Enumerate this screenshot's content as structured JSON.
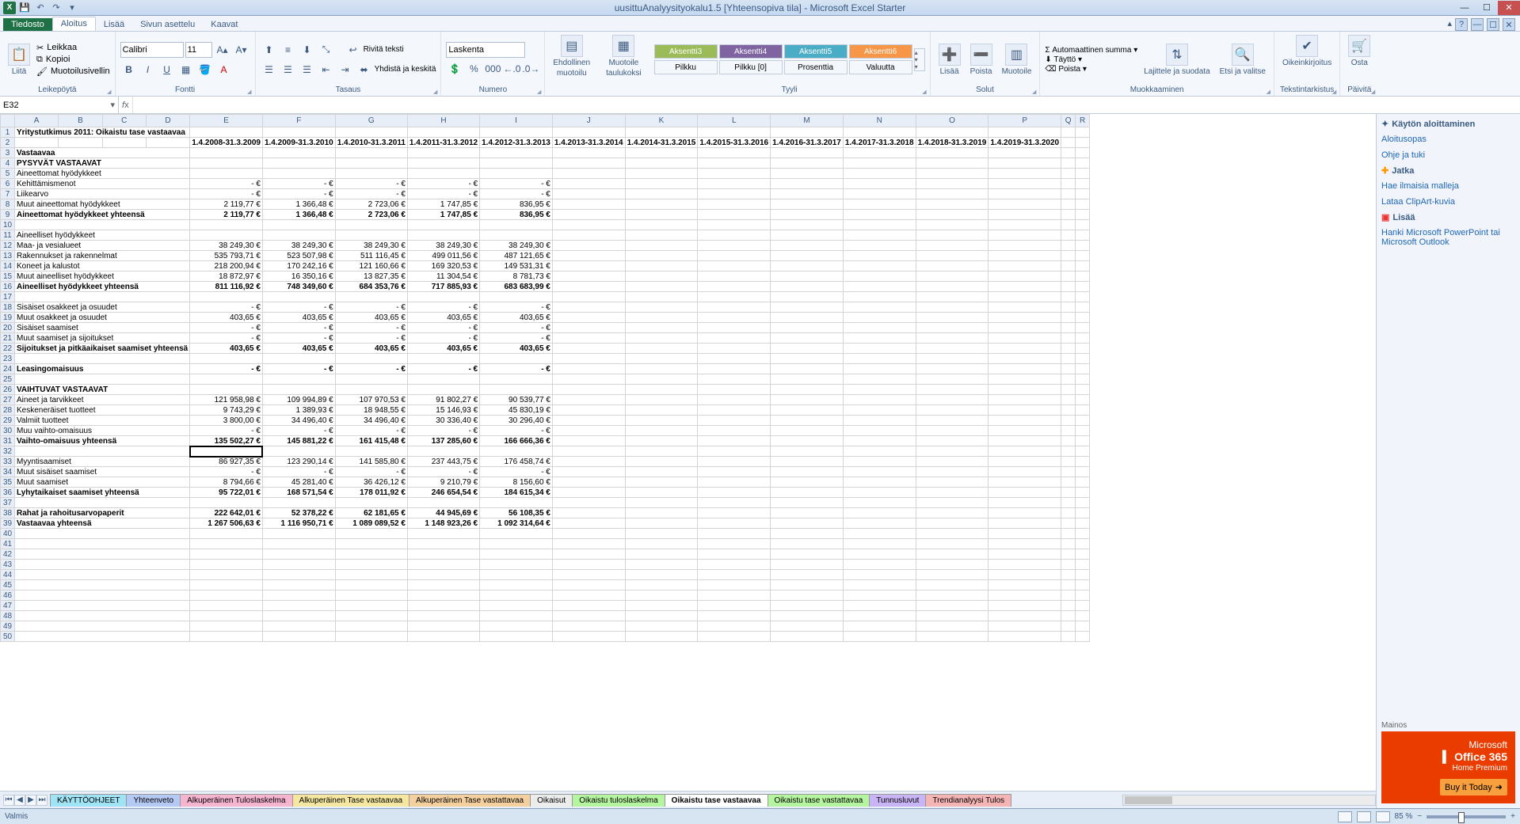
{
  "app": {
    "title": "uusittuAnalyysityokalu1.5 [Yhteensopiva tila] - Microsoft Excel Starter",
    "status": "Valmis",
    "zoom": "85 %"
  },
  "tabs": {
    "file": "Tiedosto",
    "items": [
      "Aloitus",
      "Lisää",
      "Sivun asettelu",
      "Kaavat"
    ],
    "active": "Aloitus"
  },
  "ribbon": {
    "clipboard": {
      "label": "Leikepöytä",
      "paste": "Liitä",
      "cut": "Leikkaa",
      "copy": "Kopioi",
      "painter": "Muotoilusivellin"
    },
    "font": {
      "label": "Fontti",
      "name": "Calibri",
      "size": "11"
    },
    "align": {
      "label": "Tasaus",
      "wrap": "Rivitä teksti",
      "merge": "Yhdistä ja keskitä"
    },
    "number": {
      "label": "Numero",
      "format": "Laskenta"
    },
    "cond": {
      "label1": "Ehdollinen",
      "label2": "muotoilu"
    },
    "fmttable": {
      "label1": "Muotoile",
      "label2": "taulukoksi"
    },
    "styles": {
      "label": "Tyyli",
      "accents": [
        "Aksentti3",
        "Aksentti4",
        "Aksentti5",
        "Aksentti6"
      ],
      "row2": [
        "Pilkku",
        "Pilkku [0]",
        "Prosenttia",
        "Valuutta"
      ]
    },
    "cells": {
      "label": "Solut",
      "insert": "Lisää",
      "delete": "Poista",
      "format": "Muotoile"
    },
    "editing": {
      "label": "Muokkaaminen",
      "autosum": "Automaattinen summa",
      "fill": "Täyttö",
      "clear": "Poista",
      "sort": "Lajittele ja suodata",
      "find": "Etsi ja valitse"
    },
    "proof": {
      "label": "Tekstintarkistus",
      "spell": "Oikeinkirjoitus"
    },
    "buy": {
      "label": "Päivitä",
      "action": "Osta"
    }
  },
  "namebox": "E32",
  "taskpane": {
    "h1": "Käytön aloittaminen",
    "links1": [
      "Aloitusopas",
      "Ohje ja tuki"
    ],
    "h2": "Jatka",
    "links2": [
      "Hae ilmaisia malleja",
      "Lataa ClipArt-kuvia"
    ],
    "h3": "Lisää",
    "links3": [
      "Hanki Microsoft PowerPoint tai Microsoft Outlook"
    ],
    "adlabel": "Mainos",
    "ad_brand_pre": "Microsoft",
    "ad_brand": "Office 365",
    "ad_sub": "Home Premium",
    "ad_cta": "Buy it Today"
  },
  "sheetTabs": [
    {
      "name": "KÄYTTÖOHJEET",
      "cls": "c-cyan"
    },
    {
      "name": "Yhteenveto",
      "cls": "c-blue"
    },
    {
      "name": "Alkuperäinen Tuloslaskelma",
      "cls": "c-pink"
    },
    {
      "name": "Alkuperäinen Tase vastaavaa",
      "cls": "c-yellow"
    },
    {
      "name": "Alkuperäinen Tase vastattavaa",
      "cls": "c-orange"
    },
    {
      "name": "Oikaisut",
      "cls": ""
    },
    {
      "name": "Oikaistu tuloslaskelma",
      "cls": "c-green"
    },
    {
      "name": "Oikaistu tase vastaavaa",
      "cls": "active"
    },
    {
      "name": "Oikaistu tase vastattavaa",
      "cls": "c-green"
    },
    {
      "name": "Tunnusluvut",
      "cls": "c-purple"
    },
    {
      "name": "Trendianalyysi Tulos",
      "cls": "c-red"
    }
  ],
  "chart_data": {
    "type": "table",
    "title": "Yritystutkimus 2011: Oikaistu tase vastaavaa",
    "colHeaders": [
      "A",
      "B",
      "C",
      "D",
      "E",
      "F",
      "G",
      "H",
      "I",
      "J",
      "K",
      "L",
      "M",
      "N",
      "O",
      "P",
      "Q",
      "R"
    ],
    "periods": [
      "1.4.2008-31.3.2009",
      "1.4.2009-31.3.2010",
      "1.4.2010-31.3.2011",
      "1.4.2011-31.3.2012",
      "1.4.2012-31.3.2013",
      "1.4.2013-31.3.2014",
      "1.4.2014-31.3.2015",
      "1.4.2015-31.3.2016",
      "1.4.2016-31.3.2017",
      "1.4.2017-31.3.2018",
      "1.4.2018-31.3.2019",
      "1.4.2019-31.3.2020"
    ],
    "rows": [
      {
        "n": 1,
        "label": "Yritystutkimus 2011: Oikaistu tase vastaavaa",
        "section": "title"
      },
      {
        "n": 2,
        "label": "",
        "hdr": true
      },
      {
        "n": 3,
        "label": "Vastaavaa",
        "bold": true
      },
      {
        "n": 4,
        "label": "PYSYVÄT VASTAAVAT",
        "bold": true
      },
      {
        "n": 5,
        "label": "Aineettomat hyödykkeet"
      },
      {
        "n": 6,
        "label": "Kehittämismenot",
        "v": [
          "-   €",
          "-   €",
          "-   €",
          "-   €",
          "-   €"
        ]
      },
      {
        "n": 7,
        "label": "Liikearvo",
        "v": [
          "-   €",
          "-   €",
          "-   €",
          "-   €",
          "-   €"
        ]
      },
      {
        "n": 8,
        "label": "Muut aineettomat hyödykkeet",
        "v": [
          "2 119,77 €",
          "1 366,48 €",
          "2 723,06 €",
          "1 747,85 €",
          "836,95 €"
        ]
      },
      {
        "n": 9,
        "label": "Aineettomat hyödykkeet yhteensä",
        "bold": true,
        "top": true,
        "v": [
          "2 119,77 €",
          "1 366,48 €",
          "2 723,06 €",
          "1 747,85 €",
          "836,95 €"
        ]
      },
      {
        "n": 10,
        "label": ""
      },
      {
        "n": 11,
        "label": "Aineelliset hyödykkeet"
      },
      {
        "n": 12,
        "label": "Maa- ja vesialueet",
        "v": [
          "38 249,30 €",
          "38 249,30 €",
          "38 249,30 €",
          "38 249,30 €",
          "38 249,30 €"
        ]
      },
      {
        "n": 13,
        "label": "Rakennukset ja rakennelmat",
        "v": [
          "535 793,71 €",
          "523 507,98 €",
          "511 116,45 €",
          "499 011,56 €",
          "487 121,65 €"
        ]
      },
      {
        "n": 14,
        "label": "Koneet ja kalustot",
        "v": [
          "218 200,94 €",
          "170 242,16 €",
          "121 160,66 €",
          "169 320,53 €",
          "149 531,31 €"
        ]
      },
      {
        "n": 15,
        "label": "Muut aineelliset hyödykkeet",
        "v": [
          "18 872,97 €",
          "16 350,16 €",
          "13 827,35 €",
          "11 304,54 €",
          "8 781,73 €"
        ]
      },
      {
        "n": 16,
        "label": "Aineelliset hyödykkeet yhteensä",
        "bold": true,
        "top": true,
        "v": [
          "811 116,92 €",
          "748 349,60 €",
          "684 353,76 €",
          "717 885,93 €",
          "683 683,99 €"
        ]
      },
      {
        "n": 17,
        "label": ""
      },
      {
        "n": 18,
        "label": "Sisäiset osakkeet ja osuudet",
        "v": [
          "-   €",
          "-   €",
          "-   €",
          "-   €",
          "-   €"
        ]
      },
      {
        "n": 19,
        "label": "Muut osakkeet ja osuudet",
        "v": [
          "403,65 €",
          "403,65 €",
          "403,65 €",
          "403,65 €",
          "403,65 €"
        ]
      },
      {
        "n": 20,
        "label": "Sisäiset saamiset",
        "v": [
          "-   €",
          "-   €",
          "-   €",
          "-   €",
          "-   €"
        ]
      },
      {
        "n": 21,
        "label": "Muut saamiset ja sijoitukset",
        "v": [
          "-   €",
          "-   €",
          "-   €",
          "-   €",
          "-   €"
        ]
      },
      {
        "n": 22,
        "label": "Sijoitukset ja pitkäaikaiset saamiset yhteensä",
        "bold": true,
        "top": true,
        "v": [
          "403,65 €",
          "403,65 €",
          "403,65 €",
          "403,65 €",
          "403,65 €"
        ]
      },
      {
        "n": 23,
        "label": ""
      },
      {
        "n": 24,
        "label": "Leasingomaisuus",
        "bold": true,
        "v": [
          "-   €",
          "-   €",
          "-   €",
          "-   €",
          "-   €"
        ]
      },
      {
        "n": 25,
        "label": ""
      },
      {
        "n": 26,
        "label": "VAIHTUVAT VASTAAVAT",
        "bold": true
      },
      {
        "n": 27,
        "label": "Aineet ja tarvikkeet",
        "v": [
          "121 958,98 €",
          "109 994,89 €",
          "107 970,53 €",
          "91 802,27 €",
          "90 539,77 €"
        ]
      },
      {
        "n": 28,
        "label": "Keskeneräiset tuotteet",
        "v": [
          "9 743,29 €",
          "1 389,93 €",
          "18 948,55 €",
          "15 146,93 €",
          "45 830,19 €"
        ]
      },
      {
        "n": 29,
        "label": "Valmiit tuotteet",
        "v": [
          "3 800,00 €",
          "34 496,40 €",
          "34 496,40 €",
          "30 336,40 €",
          "30 296,40 €"
        ]
      },
      {
        "n": 30,
        "label": "Muu vaihto-omaisuus",
        "v": [
          "-   €",
          "-   €",
          "-   €",
          "-   €",
          "-   €"
        ]
      },
      {
        "n": 31,
        "label": "Vaihto-omaisuus yhteensä",
        "bold": true,
        "top": true,
        "v": [
          "135 502,27 €",
          "145 881,22 €",
          "161 415,48 €",
          "137 285,60 €",
          "166 666,36 €"
        ]
      },
      {
        "n": 32,
        "label": "",
        "active": true
      },
      {
        "n": 33,
        "label": "Myyntisaamiset",
        "v": [
          "86 927,35 €",
          "123 290,14 €",
          "141 585,80 €",
          "237 443,75 €",
          "176 458,74 €"
        ]
      },
      {
        "n": 34,
        "label": "Muut sisäiset saamiset",
        "v": [
          "-   €",
          "-   €",
          "-   €",
          "-   €",
          "-   €"
        ]
      },
      {
        "n": 35,
        "label": "Muut saamiset",
        "v": [
          "8 794,66 €",
          "45 281,40 €",
          "36 426,12 €",
          "9 210,79 €",
          "8 156,60 €"
        ]
      },
      {
        "n": 36,
        "label": "Lyhytaikaiset saamiset yhteensä",
        "bold": true,
        "top": true,
        "v": [
          "95 722,01 €",
          "168 571,54 €",
          "178 011,92 €",
          "246 654,54 €",
          "184 615,34 €"
        ]
      },
      {
        "n": 37,
        "label": ""
      },
      {
        "n": 38,
        "label": "Rahat ja rahoitusarvopaperit",
        "bold": true,
        "v": [
          "222 642,01 €",
          "52 378,22 €",
          "62 181,65 €",
          "44 945,69 €",
          "56 108,35 €"
        ]
      },
      {
        "n": 39,
        "label": "Vastaavaa yhteensä",
        "bold": true,
        "top": true,
        "v": [
          "1 267 506,63 €",
          "1 116 950,71 €",
          "1 089 089,52 €",
          "1 148 923,26 €",
          "1 092 314,64 €"
        ]
      },
      {
        "n": 40,
        "label": ""
      },
      {
        "n": 41,
        "label": ""
      },
      {
        "n": 42,
        "label": ""
      },
      {
        "n": 43,
        "label": ""
      },
      {
        "n": 44,
        "label": ""
      },
      {
        "n": 45,
        "label": ""
      },
      {
        "n": 46,
        "label": ""
      },
      {
        "n": 47,
        "label": ""
      },
      {
        "n": 48,
        "label": ""
      },
      {
        "n": 49,
        "label": ""
      },
      {
        "n": 50,
        "label": ""
      }
    ]
  }
}
